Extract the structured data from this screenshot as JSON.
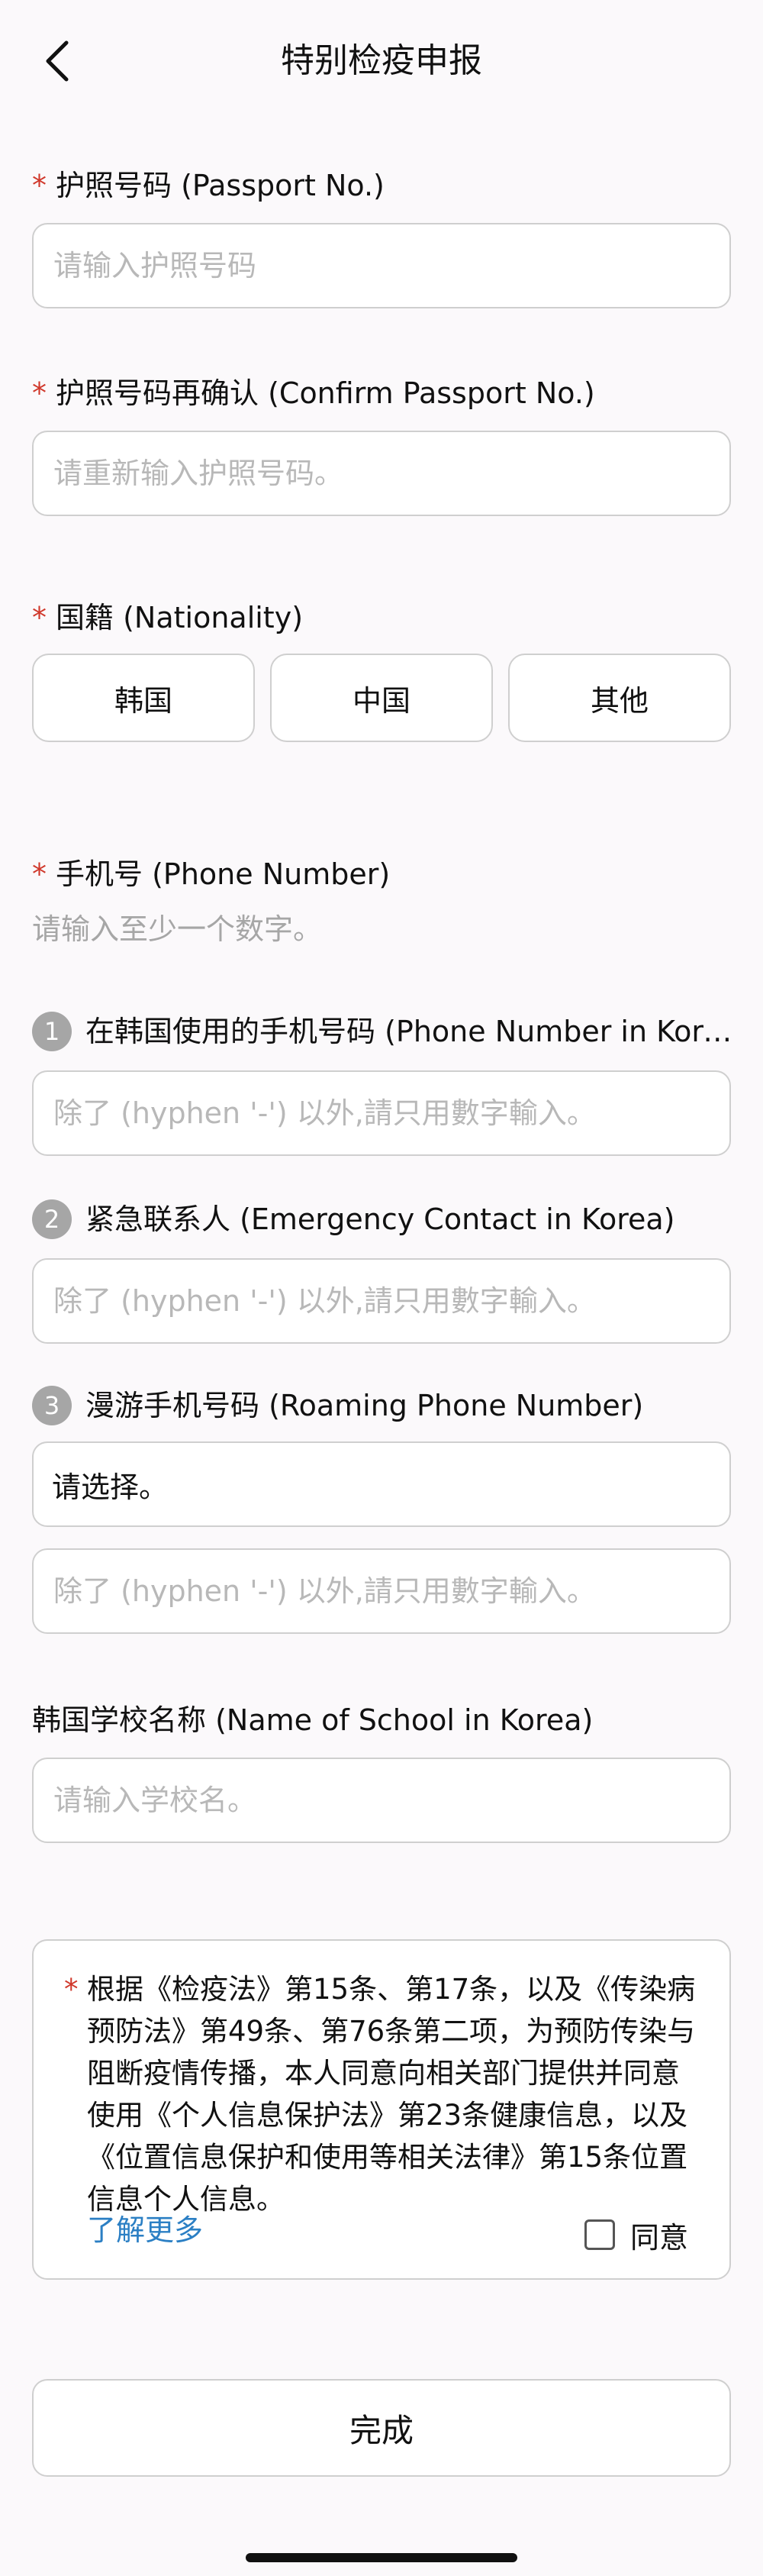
{
  "header": {
    "title": "特别检疫申报",
    "back_icon": "chevron-left-icon"
  },
  "required_mark": "*",
  "passport": {
    "label": "护照号码 (Passport No.)",
    "placeholder": "请输入护照号码",
    "value": ""
  },
  "passport_confirm": {
    "label": "护照号码再确认 (Confirm Passport No.)",
    "placeholder": "请重新输入护照号码。",
    "value": ""
  },
  "nationality": {
    "label": "国籍 (Nationality)",
    "options": [
      "韩国",
      "中国",
      "其他"
    ]
  },
  "phone": {
    "label": "手机号 (Phone Number)",
    "hint": "请输入至少一个数字。",
    "korea": {
      "number": "1",
      "label": "在韩国使用的手机号码 (Phone Number in Korea)",
      "placeholder": "除了 (hyphen '-') 以外,請只用數字輸入。"
    },
    "emergency": {
      "number": "2",
      "label": "紧急联系人 (Emergency Contact in Korea)",
      "placeholder": "除了 (hyphen '-') 以外,請只用數字輸入。"
    },
    "roaming": {
      "number": "3",
      "label": "漫游手机号码 (Roaming Phone Number)",
      "select_value": "请选择。",
      "placeholder": "除了 (hyphen '-') 以外,請只用數字輸入。"
    }
  },
  "school": {
    "label": "韩国学校名称 (Name of School in Korea)",
    "placeholder": "请输入学校名。"
  },
  "consent": {
    "text": "根据《检疫法》第15条、第17条，以及《传染病预防法》第49条、第76条第二项，为预防传染与阻断疫情传播，本人同意向相关部门提供并同意使用《个人信息保护法》第23条健康信息，以及《位置信息保护和使用等相关法律》第15条位置信息个人信息。",
    "learn_more": "了解更多",
    "agree_label": "同意",
    "checked": false
  },
  "submit_label": "完成"
}
